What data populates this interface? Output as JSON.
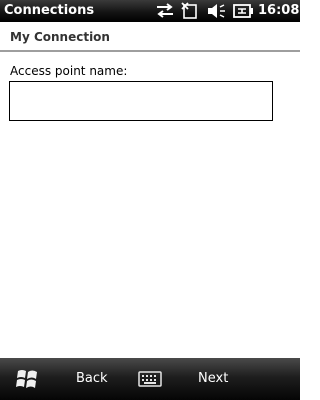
{
  "status_bar": {
    "app_title": "Connections",
    "clock": "16:08",
    "icons": [
      "data-connection-icon",
      "no-signal-icon",
      "volume-icon",
      "battery-charging-icon"
    ]
  },
  "page": {
    "title": "My Connection"
  },
  "form": {
    "access_point_label": "Access point name:",
    "access_point_value": "",
    "access_point_placeholder": ""
  },
  "softkeys": {
    "start_icon": "windows-start-icon",
    "left_label": "Back",
    "center_icon": "keyboard-icon",
    "right_label": "Next"
  },
  "colors": {
    "bar_background": "#000000",
    "header_divider": "#9e9e9e",
    "text": "#000000",
    "header_text": "#333333"
  }
}
